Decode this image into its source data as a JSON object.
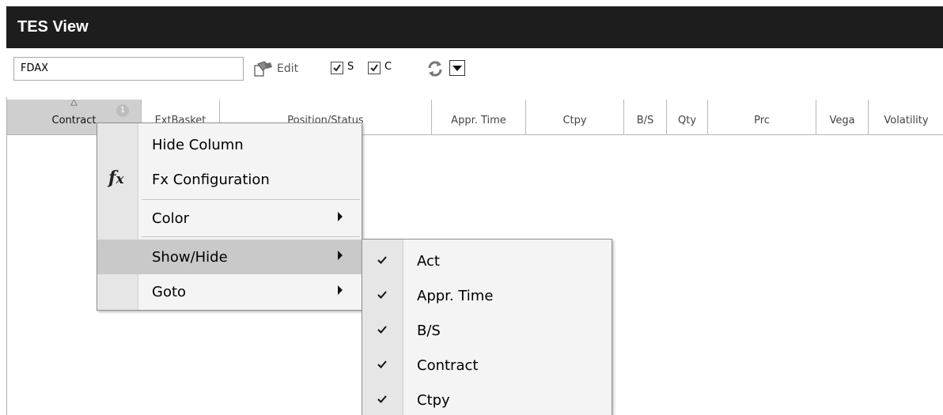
{
  "window": {
    "title": "TES View"
  },
  "toolbar": {
    "search_value": "FDAX",
    "edit_label": "Edit",
    "check_s": {
      "label": "S",
      "checked": true
    },
    "check_c": {
      "label": "C",
      "checked": true
    },
    "refresh_icon": "refresh-icon",
    "dropdown_icon": "chevron-down-icon"
  },
  "grid": {
    "columns": [
      {
        "label": "Contract",
        "sorted": true,
        "sort_order": "1"
      },
      {
        "label": "ExtBasket"
      },
      {
        "label": "Position/Status"
      },
      {
        "label": "Appr. Time"
      },
      {
        "label": "Ctpy"
      },
      {
        "label": "B/S"
      },
      {
        "label": "Qty"
      },
      {
        "label": "Prc"
      },
      {
        "label": "Vega"
      },
      {
        "label": "Volatility"
      }
    ],
    "sort_indicator": "△"
  },
  "context_menu": {
    "items": [
      {
        "label": "Hide Column"
      },
      {
        "label": "Fx Configuration",
        "icon": "fx-icon",
        "icon_text": "fx"
      },
      {
        "label": "Color",
        "submenu": true
      },
      {
        "label": "Show/Hide",
        "submenu": true,
        "highlighted": true
      },
      {
        "label": "Goto",
        "submenu": true
      }
    ]
  },
  "show_hide_submenu": {
    "items": [
      {
        "label": "Act",
        "checked": true
      },
      {
        "label": "Appr. Time",
        "checked": true
      },
      {
        "label": "B/S",
        "checked": true
      },
      {
        "label": "Contract",
        "checked": true
      },
      {
        "label": "Ctpy",
        "checked": true
      }
    ]
  }
}
